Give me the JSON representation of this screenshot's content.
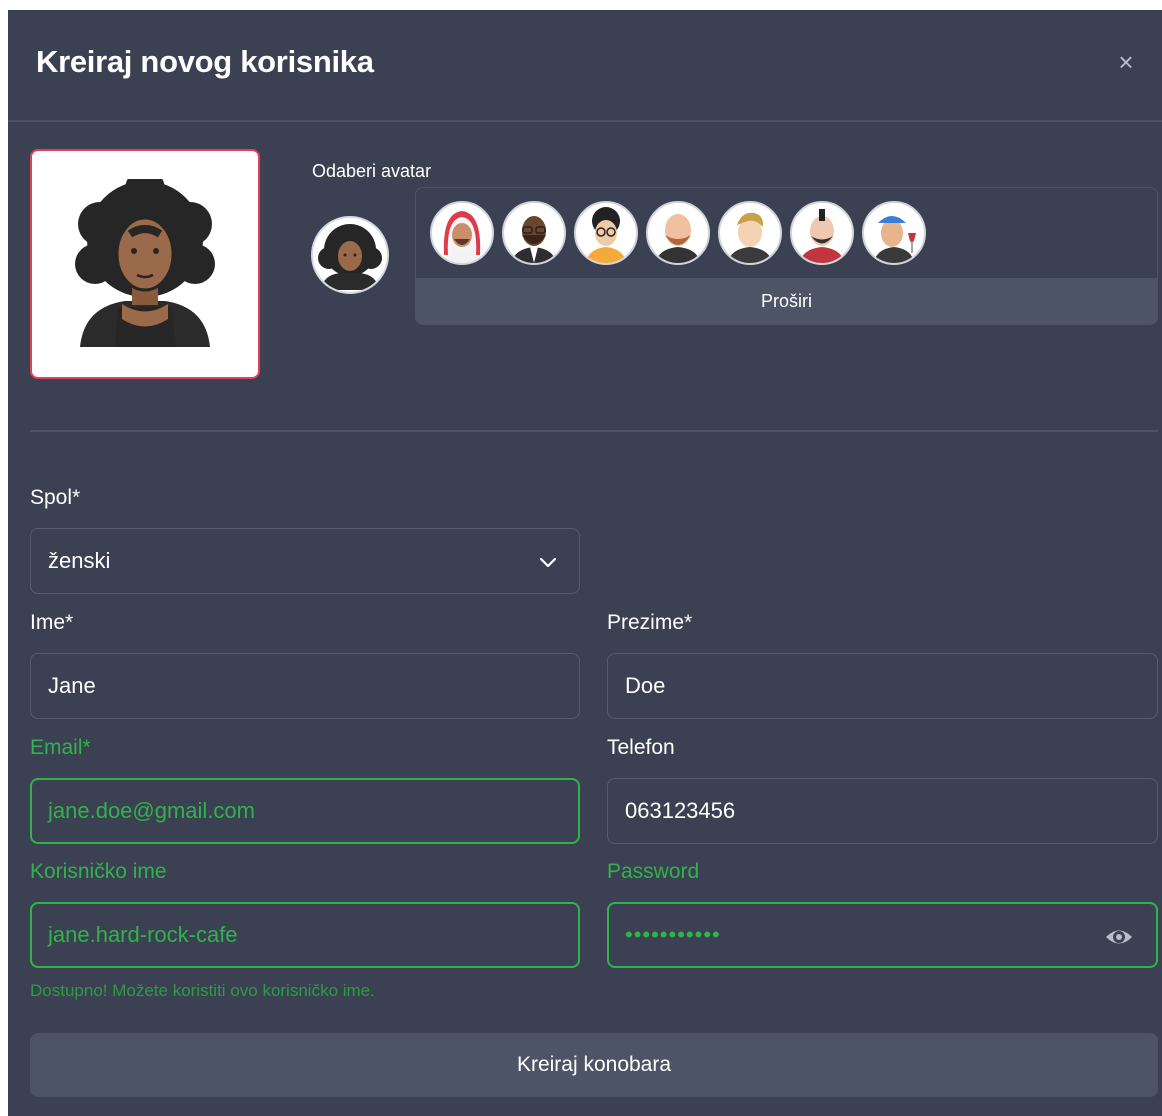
{
  "modal": {
    "title": "Kreiraj novog korisnika",
    "close_label": "×"
  },
  "avatar": {
    "pick_label": "Odaberi avatar",
    "selected": "woman-afro-avatar",
    "options": [
      "man-keffiyeh-avatar",
      "man-glasses-beard-avatar",
      "man-curly-glasses-avatar",
      "man-bald-beard-avatar",
      "man-blond-avatar",
      "man-mohawk-avatar",
      "woman-cap-wine-avatar"
    ],
    "expand_label": "Proširi"
  },
  "form": {
    "gender": {
      "label": "Spol*",
      "value": "ženski"
    },
    "first_name": {
      "label": "Ime*",
      "value": "Jane"
    },
    "last_name": {
      "label": "Prezime*",
      "value": "Doe"
    },
    "email": {
      "label": "Email*",
      "value": "jane.doe@gmail.com"
    },
    "phone": {
      "label": "Telefon",
      "value": "063123456"
    },
    "username": {
      "label": "Korisničko ime",
      "value": "jane.hard-rock-cafe",
      "hint": "Dostupno! Možete koristiti ovo korisničko ime."
    },
    "password": {
      "label": "Password",
      "value": "•••••••••••"
    }
  },
  "submit_label": "Kreiraj konobara",
  "colors": {
    "background": "#3b4152",
    "success": "#2fb34a",
    "error_border": "#e0405f",
    "button": "#4d5466"
  }
}
